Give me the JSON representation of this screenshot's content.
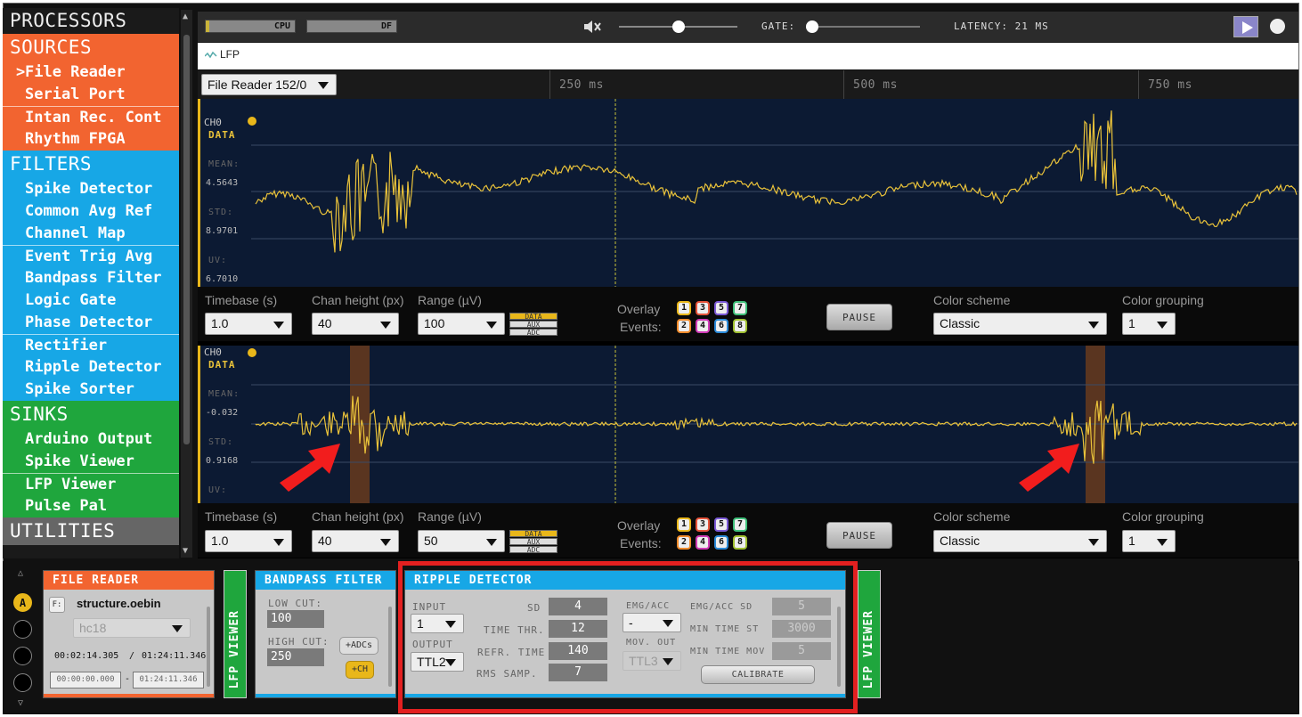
{
  "sidebar": {
    "title": "PROCESSORS",
    "sources": {
      "label": "SOURCES",
      "items": [
        "File Reader",
        "Serial Port",
        "Intan Rec. Cont",
        "Rhythm FPGA"
      ]
    },
    "filters": {
      "label": "FILTERS",
      "items": [
        "Spike Detector",
        "Common Avg Ref",
        "Channel Map",
        "Event Trig Avg",
        "Bandpass Filter",
        "Logic Gate",
        "Phase Detector",
        "Rectifier",
        "Ripple Detector",
        "Spike Sorter"
      ]
    },
    "sinks": {
      "label": "SINKS",
      "items": [
        "Arduino Output",
        "Spike Viewer",
        "LFP Viewer",
        "Pulse Pal"
      ]
    },
    "utilities": {
      "label": "UTILITIES"
    },
    "selected_marker": ">"
  },
  "topbar": {
    "cpu_label": "CPU",
    "df_label": "DF",
    "gate_label": "GATE:",
    "latency_label": "LATENCY: 21 MS",
    "volume_level": 0.5,
    "gate_level": 0.0
  },
  "tabs": {
    "lfp": "LFP"
  },
  "lfp": {
    "source_select": "File Reader 152/0",
    "ticks": [
      "250 ms",
      "500 ms",
      "750 ms"
    ],
    "panel1": {
      "channel": "CH0",
      "data": "DATA",
      "mean_label": "MEAN:",
      "mean": "4.5643",
      "std_label": "STD:",
      "std": "8.9701",
      "uv_label": "UV:",
      "uv": "6.7010"
    },
    "panel2": {
      "channel": "CH0",
      "data": "DATA",
      "mean_label": "MEAN:",
      "mean": "-0.032",
      "std_label": "STD:",
      "std": "0.9168",
      "uv_label": "UV:"
    },
    "controls1": {
      "timebase_label": "Timebase (s)",
      "timebase": "1.0",
      "chan_height_label": "Chan height (px)",
      "chan_height": "40",
      "range_label": "Range (µV)",
      "range": "100",
      "overlay_label": "Overlay",
      "events_label": "Events:",
      "pause": "PAUSE",
      "color_scheme_label": "Color scheme",
      "color_scheme": "Classic",
      "color_grouping_label": "Color grouping",
      "color_grouping": "1"
    },
    "controls2": {
      "timebase_label": "Timebase (s)",
      "timebase": "1.0",
      "chan_height_label": "Chan height (px)",
      "chan_height": "40",
      "range_label": "Range (µV)",
      "range": "50",
      "overlay_label": "Overlay",
      "events_label": "Events:",
      "pause": "PAUSE",
      "color_scheme_label": "Color scheme",
      "color_scheme": "Classic",
      "color_grouping_label": "Color grouping",
      "color_grouping": "1"
    },
    "dar": [
      "DATA",
      "AUX",
      "ADC"
    ],
    "events_top": [
      "1",
      "3",
      "5",
      "7"
    ],
    "events_bottom": [
      "2",
      "4",
      "6",
      "8"
    ]
  },
  "editor": {
    "tab_marker": "A",
    "file_reader": {
      "title": "FILE READER",
      "f_button": "F:",
      "filename": "structure.oebin",
      "stream": "hc18",
      "time_current": "00:02:14.305",
      "time_sep": "/",
      "time_total": "01:24:11.346",
      "range_start": "00:00:00.000",
      "range_dash": "-",
      "range_end": "01:24:11.346"
    },
    "lfp_viewer_1": "LFP VIEWER",
    "bandpass": {
      "title": "BANDPASS FILTER",
      "low_cut_label": "LOW CUT:",
      "low_cut": "100",
      "high_cut_label": "HIGH CUT:",
      "high_cut": "250",
      "adcs_button": "+ADCs",
      "ch_button": "+CH"
    },
    "ripple": {
      "title": "RIPPLE DETECTOR",
      "input_label": "INPUT",
      "input": "1",
      "output_label": "OUTPUT",
      "output": "TTL2",
      "sd_label": "SD",
      "sd": "4",
      "time_thr_label": "TIME THR.",
      "time_thr": "12",
      "refr_time_label": "REFR. TIME",
      "refr_time": "140",
      "rms_samp_label": "RMS SAMP.",
      "rms_samp": "7",
      "emg_label": "EMG/ACC",
      "emg": "-",
      "mov_out_label": "MOV. OUT",
      "mov_out": "TTL3",
      "emg_sd_label": "EMG/ACC SD",
      "emg_sd": "5",
      "min_time_st_label": "MIN TIME ST",
      "min_time_st": "3000",
      "min_time_mov_label": "MIN TIME MOV",
      "min_time_mov": "5",
      "calibrate": "CALIBRATE"
    },
    "lfp_viewer_2": "LFP VIEWER"
  },
  "colors": {
    "sources": "#f26430",
    "filters": "#17a7e6",
    "sinks": "#1fa63d",
    "trace": "#e9c23a",
    "highlight": "#e32020"
  }
}
